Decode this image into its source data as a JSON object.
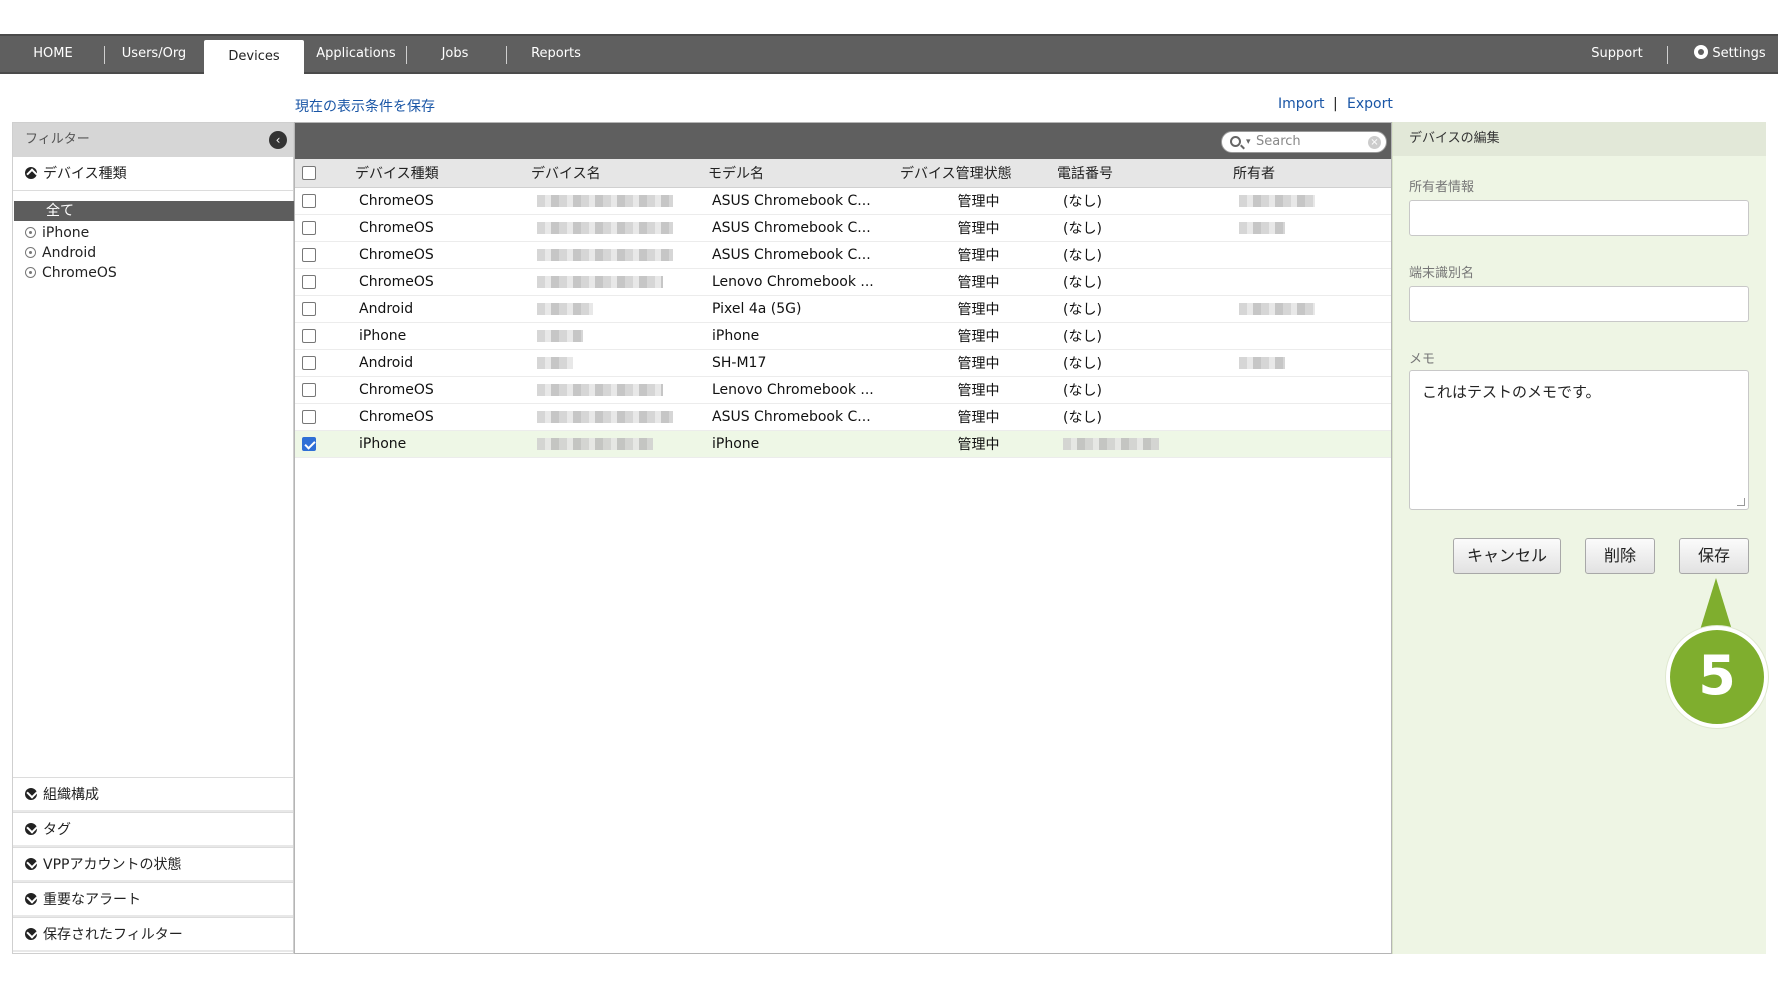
{
  "nav": {
    "home": "HOME",
    "users_org": "Users/Org",
    "devices": "Devices",
    "applications": "Applications",
    "jobs": "Jobs",
    "reports": "Reports",
    "support": "Support",
    "settings": "Settings"
  },
  "links": {
    "save_view": "現在の表示条件を保存",
    "import": "Import",
    "sep": "|",
    "export": "Export"
  },
  "filter": {
    "title": "フィルター",
    "device_types_heading": "デバイス種類",
    "types": [
      {
        "label": "全て",
        "selected": true
      },
      {
        "label": "iPhone"
      },
      {
        "label": "Android"
      },
      {
        "label": "ChromeOS"
      }
    ],
    "sections": [
      "組織構成",
      "タグ",
      "VPPアカウントの状態",
      "重要なアラート",
      "保存されたフィルター"
    ]
  },
  "search": {
    "placeholder": "Search"
  },
  "table": {
    "headers": [
      "デバイス種類",
      "デバイス名",
      "モデル名",
      "デバイス管理状態",
      "電話番号",
      "所有者"
    ],
    "rows": [
      {
        "type": "ChromeOS",
        "model": "ASUS Chromebook C...",
        "status": "管理中",
        "phone": "(なし)",
        "checked": false
      },
      {
        "type": "ChromeOS",
        "model": "ASUS Chromebook C...",
        "status": "管理中",
        "phone": "(なし)",
        "checked": false
      },
      {
        "type": "ChromeOS",
        "model": "ASUS Chromebook C...",
        "status": "管理中",
        "phone": "(なし)",
        "checked": false
      },
      {
        "type": "ChromeOS",
        "model": "Lenovo Chromebook ...",
        "status": "管理中",
        "phone": "(なし)",
        "checked": false
      },
      {
        "type": "Android",
        "model": "Pixel 4a (5G)",
        "status": "管理中",
        "phone": "(なし)",
        "checked": false
      },
      {
        "type": "iPhone",
        "model": "iPhone",
        "status": "管理中",
        "phone": "(なし)",
        "checked": false
      },
      {
        "type": "Android",
        "model": "SH-M17",
        "status": "管理中",
        "phone": "(なし)",
        "checked": false
      },
      {
        "type": "ChromeOS",
        "model": "Lenovo Chromebook ...",
        "status": "管理中",
        "phone": "(なし)",
        "checked": false
      },
      {
        "type": "ChromeOS",
        "model": "ASUS Chromebook C...",
        "status": "管理中",
        "phone": "(なし)",
        "checked": false
      },
      {
        "type": "iPhone",
        "model": "iPhone",
        "status": "管理中",
        "phone": "",
        "checked": true
      }
    ]
  },
  "edit": {
    "title": "デバイスの編集",
    "owner_label": "所有者情報",
    "alias_label": "端末識別名",
    "memo_label": "メモ",
    "memo_value": "これはテストのメモです。",
    "cancel": "キャンセル",
    "delete": "削除",
    "save": "保存"
  },
  "callout": {
    "step": "5"
  },
  "colors": {
    "nav_bg": "#5f5f5f",
    "link": "#1a56a6",
    "edit_bg": "#eef5e4",
    "callout": "#7fae2e",
    "checkbox": "#2f6fd6"
  }
}
